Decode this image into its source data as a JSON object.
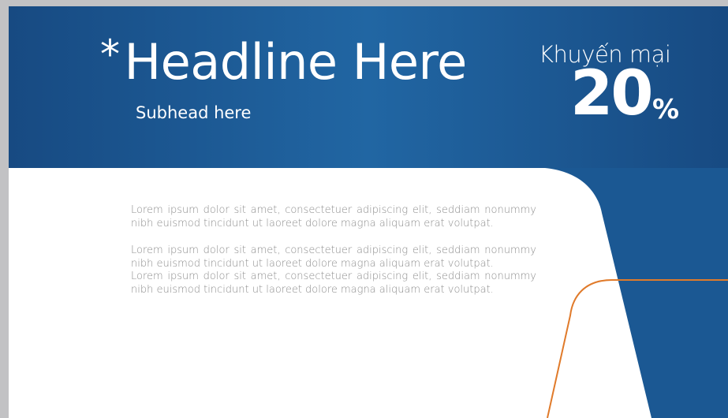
{
  "headline": {
    "asterisk": "*",
    "text": "Headline Here"
  },
  "subhead": "Subhead here",
  "promo": {
    "label": "Khuyến mại",
    "value": "20",
    "unit": "%"
  },
  "paragraphs": [
    "Lorem ipsum dolor sit amet, consectetuer adipiscing elit, seddiam nonummy nibh euismod tincidunt ut laoreet dolore magna aliquam erat volutpat.",
    "Lorem ipsum dolor sit amet, consectetuer adipiscing elit, seddiam nonummy nibh euismod tincidunt ut laoreet dolore magna aliquam erat volutpat.",
    "Lorem ipsum dolor sit amet, consectetuer adipiscing elit, seddiam nonummy nibh euismod tincidunt ut laoreet dolore magna aliquam erat volutpat."
  ],
  "colors": {
    "header_blue": "#1b5893",
    "header_blue_light": "#2166a3",
    "accent_orange": "#e07a2a",
    "page_gray": "#c2c2c4"
  }
}
